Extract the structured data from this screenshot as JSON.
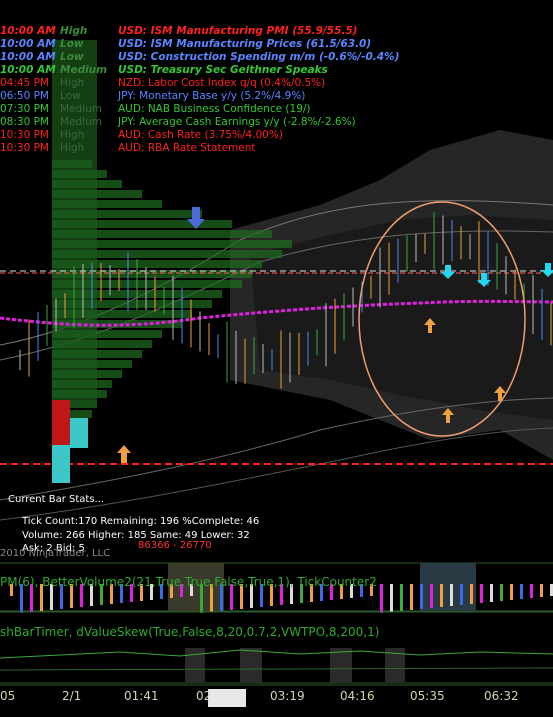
{
  "news": [
    {
      "time": "10:00 AM",
      "impact": "High",
      "event": "USD: ISM Manufacturing PMI (55.9/55.5)",
      "color": "#ff2020",
      "bold": true
    },
    {
      "time": "10:00 AM",
      "impact": "Low",
      "event": "USD: ISM Manufacturing Prices (61.5/63.0)",
      "color": "#5a86ff",
      "bold": true
    },
    {
      "time": "10:00 AM",
      "impact": "Low",
      "event": "USD: Construction Spending m/m (-0.6%/-0.4%)",
      "color": "#5a86ff",
      "bold": true
    },
    {
      "time": "10:00 AM",
      "impact": "Medium",
      "event": "USD: Treasury Sec Geithner Speaks",
      "color": "#34c734",
      "bold": true
    },
    {
      "time": "04:45 PM",
      "impact": "High",
      "event": "NZD: Labor Cost Index q/q (0.4%/0.5%)",
      "color": "#ff2020",
      "bold": false
    },
    {
      "time": "06:50 PM",
      "impact": "Low",
      "event": "JPY: Monetary Base y/y (5.2%/4.9%)",
      "color": "#5a86ff",
      "bold": false
    },
    {
      "time": "07:30 PM",
      "impact": "Medium",
      "event": "AUD: NAB Business Confidence (19/)",
      "color": "#34c734",
      "bold": false
    },
    {
      "time": "08:30 PM",
      "impact": "Medium",
      "event": "JPY: Average Cash Earnings y/y (-2.8%/-2.6%)",
      "color": "#34c734",
      "bold": false
    },
    {
      "time": "10:30 PM",
      "impact": "High",
      "event": "AUD: Cash Rate (3.75%/4.00%)",
      "color": "#ff2020",
      "bold": false
    },
    {
      "time": "10:30 PM",
      "impact": "High",
      "event": "AUD: RBA Rate Statement",
      "color": "#ff2020",
      "bold": false
    }
  ],
  "stats": {
    "title": "Current Bar Stats...",
    "line1": "Tick Count:170  Remaining: 196  %Complete: 46",
    "line2": "Volume: 266  Higher: 185  Same: 49  Lower: 32",
    "line3": "Ask: 2  Bid: 5",
    "copyright": "2010 NinjaTrader, LLC",
    "price_pair": "86366 - 26770"
  },
  "panels": {
    "indicator1": "PM(6), BetterVolume2(21,True,True,False,True,1), TickCounter2",
    "indicator2": "shBarTimer, dValueSkew(True,False,8,20,0.7,2,VWTPO,8,200,1)"
  },
  "xaxis": [
    "05",
    "2/1",
    "01:41",
    "02",
    "03:19",
    "04:16",
    "05:35",
    "06:32"
  ],
  "colors": {
    "background": "#000000",
    "profile": "#1e7a1e",
    "ma": "#e020e0",
    "reference": "#ff2020",
    "ellipse": "#f0a070",
    "accent": "#3a5a2a"
  }
}
